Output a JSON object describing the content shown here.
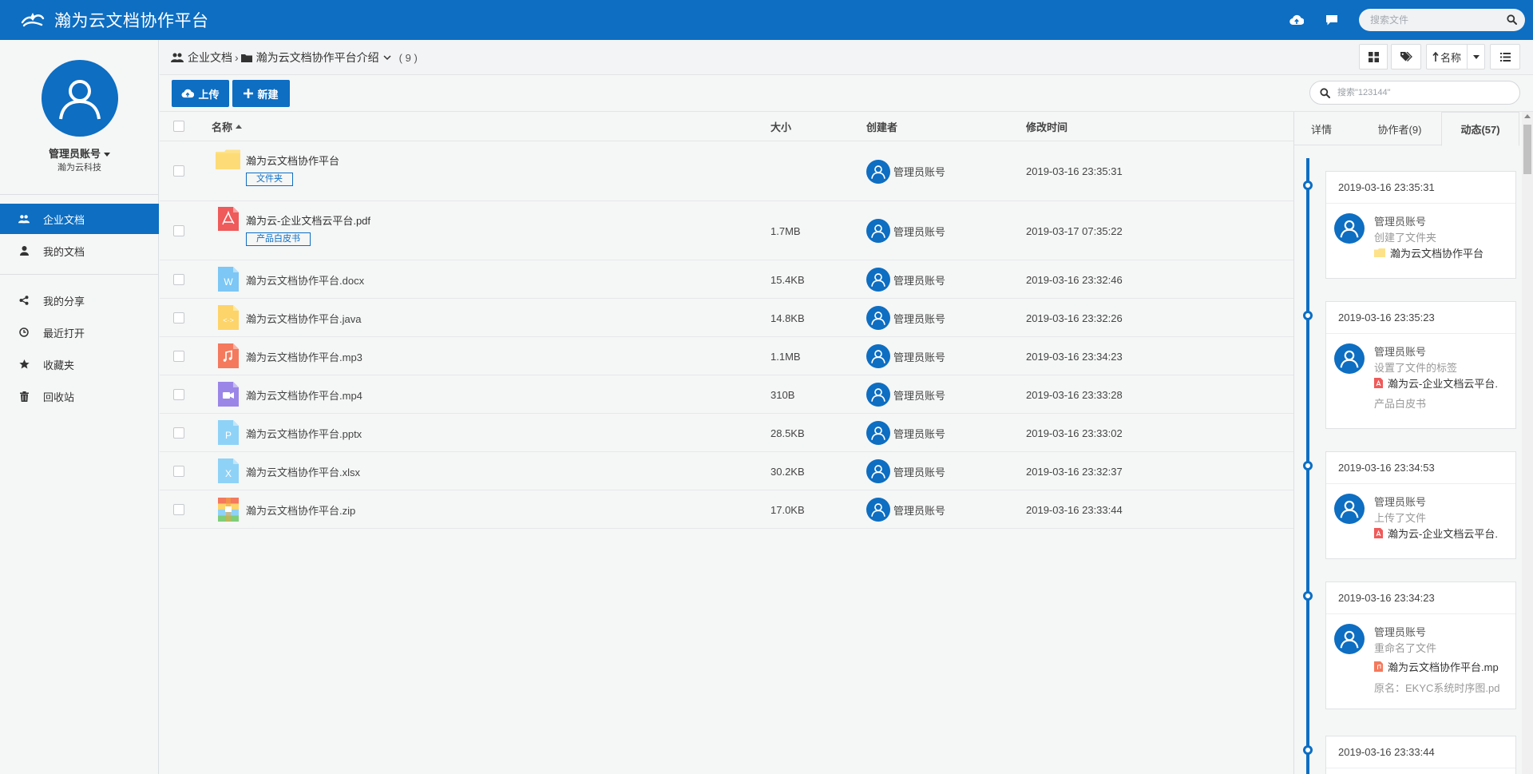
{
  "app": {
    "title": "瀚为云文档协作平台"
  },
  "header": {
    "search_placeholder": "搜索文件"
  },
  "user": {
    "name": "管理员账号",
    "org": "瀚为云科技"
  },
  "nav": {
    "items": [
      {
        "label": "企业文档",
        "icon": "users-icon",
        "active": true
      },
      {
        "label": "我的文档",
        "icon": "user-icon"
      },
      {
        "label": "我的分享",
        "icon": "share-icon"
      },
      {
        "label": "最近打开",
        "icon": "clock-icon"
      },
      {
        "label": "收藏夹",
        "icon": "star-icon"
      },
      {
        "label": "回收站",
        "icon": "trash-icon"
      }
    ]
  },
  "breadcrumb": {
    "root": "企业文档",
    "current": "瀚为云文档协作平台介绍",
    "count": "( 9 )"
  },
  "toolbar": {
    "sort_label": "名称",
    "upload_label": "上传",
    "new_label": "新建",
    "search_placeholder": "搜索\"123144\""
  },
  "table": {
    "headers": {
      "name": "名称",
      "size": "大小",
      "creator": "创建者",
      "modified": "修改时间"
    },
    "rows": [
      {
        "name": "瀚为云文档协作平台",
        "tag": "文件夹",
        "size": "",
        "creator": "管理员账号",
        "modified": "2019-03-16 23:35:31",
        "type": "folder"
      },
      {
        "name": "瀚为云-企业文档云平台.pdf",
        "tag": "产品白皮书",
        "size": "1.7MB",
        "creator": "管理员账号",
        "modified": "2019-03-17 07:35:22",
        "type": "pdf"
      },
      {
        "name": "瀚为云文档协作平台.docx",
        "size": "15.4KB",
        "creator": "管理员账号",
        "modified": "2019-03-16 23:32:46",
        "type": "docx"
      },
      {
        "name": "瀚为云文档协作平台.java",
        "size": "14.8KB",
        "creator": "管理员账号",
        "modified": "2019-03-16 23:32:26",
        "type": "java"
      },
      {
        "name": "瀚为云文档协作平台.mp3",
        "size": "1.1MB",
        "creator": "管理员账号",
        "modified": "2019-03-16 23:34:23",
        "type": "mp3"
      },
      {
        "name": "瀚为云文档协作平台.mp4",
        "size": "310B",
        "creator": "管理员账号",
        "modified": "2019-03-16 23:33:28",
        "type": "mp4"
      },
      {
        "name": "瀚为云文档协作平台.pptx",
        "size": "28.5KB",
        "creator": "管理员账号",
        "modified": "2019-03-16 23:33:02",
        "type": "pptx"
      },
      {
        "name": "瀚为云文档协作平台.xlsx",
        "size": "30.2KB",
        "creator": "管理员账号",
        "modified": "2019-03-16 23:32:37",
        "type": "xlsx"
      },
      {
        "name": "瀚为云文档协作平台.zip",
        "size": "17.0KB",
        "creator": "管理员账号",
        "modified": "2019-03-16 23:33:44",
        "type": "zip"
      }
    ]
  },
  "panel": {
    "tabs": [
      {
        "label": "详情"
      },
      {
        "label": "协作者(9)"
      },
      {
        "label": "动态(57)",
        "active": true
      }
    ],
    "activities": [
      {
        "time": "2019-03-16 23:35:31",
        "user": "管理员账号",
        "action": "创建了文件夹",
        "file": "瀚为云文档协作平台",
        "file_type": "folder"
      },
      {
        "time": "2019-03-16 23:35:23",
        "user": "管理员账号",
        "action": "设置了文件的标签",
        "file": "瀚为云-企业文档云平台.",
        "file_type": "pdf",
        "extra": "产品白皮书"
      },
      {
        "time": "2019-03-16 23:34:53",
        "user": "管理员账号",
        "action": "上传了文件",
        "file": "瀚为云-企业文档云平台.",
        "file_type": "pdf"
      },
      {
        "time": "2019-03-16 23:34:23",
        "user": "管理员账号",
        "action": "重命名了文件",
        "file": "瀚为云文档协作平台.mp",
        "file_type": "mp3",
        "extra": "原名：EKYC系统时序图.pd"
      },
      {
        "time": "2019-03-16 23:33:44"
      }
    ]
  },
  "colors": {
    "brand": "#0d6ec2",
    "folder": "#fde28a",
    "pdf": "#ef5a5a"
  }
}
